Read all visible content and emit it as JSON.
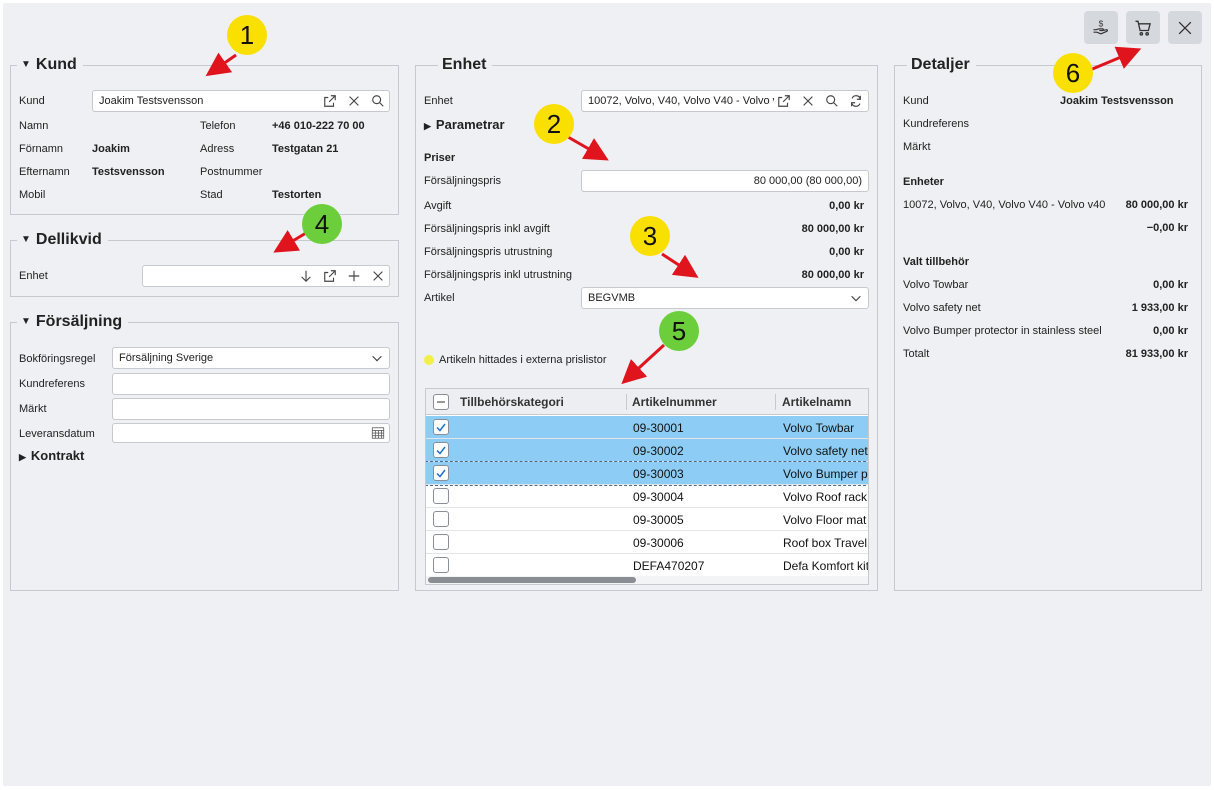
{
  "toolbar": {
    "payment_icon": "hand-coin-icon",
    "cart_icon": "cart-icon",
    "close_icon": "close-icon"
  },
  "badges": [
    "1",
    "2",
    "3",
    "4",
    "5",
    "6"
  ],
  "kund": {
    "title": "Kund",
    "kund_label": "Kund",
    "kund_value": "Joakim Testsvensson",
    "namn_label": "Namn",
    "fornamn_label": "Förnamn",
    "fornamn_value": "Joakim",
    "efternamn_label": "Efternamn",
    "efternamn_value": "Testsvensson",
    "mobil_label": "Mobil",
    "telefon_label": "Telefon",
    "telefon_value": "+46 010-222 70 00",
    "adress_label": "Adress",
    "adress_value": "Testgatan 21",
    "postnummer_label": "Postnummer",
    "stad_label": "Stad",
    "stad_value": "Testorten"
  },
  "dellikvid": {
    "title": "Dellikvid",
    "enhet_label": "Enhet",
    "enhet_value": ""
  },
  "forsaljning": {
    "title": "Försäljning",
    "bokforingsregel_label": "Bokföringsregel",
    "bokforingsregel_value": "Försäljning Sverige",
    "kundreferens_label": "Kundreferens",
    "markt_label": "Märkt",
    "leveransdatum_label": "Leveransdatum",
    "kontrakt_label": "Kontrakt"
  },
  "enhet": {
    "title": "Enhet",
    "enhet_label": "Enhet",
    "enhet_value": "10072, Volvo, V40, Volvo V40 - Volvo v40",
    "parametrar_label": "Parametrar",
    "priser_label": "Priser",
    "forsaljningspris_label": "Försäljningspris",
    "forsaljningspris_value": "80 000,00 (80 000,00)",
    "avgift_label": "Avgift",
    "avgift_value": "0,00 kr",
    "pris_inkl_avgift_label": "Försäljningspris inkl avgift",
    "pris_inkl_avgift_value": "80 000,00 kr",
    "pris_utrustning_label": "Försäljningspris utrustning",
    "pris_utrustning_value": "0,00 kr",
    "pris_inkl_utrustning_label": "Försäljningspris inkl utrustning",
    "pris_inkl_utrustning_value": "80 000,00 kr",
    "artikel_label": "Artikel",
    "artikel_value": "BEGVMB",
    "info_text": "Artikeln hittades i externa prislistor",
    "info_color": "#f2ee4a"
  },
  "grid": {
    "columns": [
      "Tillbehörskategori",
      "Artikelnummer",
      "Artikelnamn"
    ],
    "rows": [
      {
        "checked": true,
        "category": "",
        "number": "09-30001",
        "name": "Volvo Towbar"
      },
      {
        "checked": true,
        "category": "",
        "number": "09-30002",
        "name": "Volvo safety net"
      },
      {
        "checked": true,
        "category": "",
        "number": "09-30003",
        "name": "Volvo Bumper p"
      },
      {
        "checked": false,
        "category": "",
        "number": "09-30004",
        "name": "Volvo Roof rack"
      },
      {
        "checked": false,
        "category": "",
        "number": "09-30005",
        "name": "Volvo Floor mat"
      },
      {
        "checked": false,
        "category": "",
        "number": "09-30006",
        "name": "Roof box Travel"
      },
      {
        "checked": false,
        "category": "",
        "number": "DEFA470207",
        "name": "Defa Komfort kit"
      }
    ],
    "selected_color": "#8dcdf5"
  },
  "detaljer": {
    "title": "Detaljer",
    "kund_label": "Kund",
    "kund_value": "Joakim Testsvensson",
    "kundreferens_label": "Kundreferens",
    "markt_label": "Märkt",
    "enheter_label": "Enheter",
    "enhet_name": "10072, Volvo, V40, Volvo V40 - Volvo v40",
    "enhet_price": "80 000,00 kr",
    "enhet_discount": "−0,00 kr",
    "tillbehor_label": "Valt tillbehör",
    "tillbehor": [
      {
        "name": "Volvo Towbar",
        "price": "0,00 kr"
      },
      {
        "name": "Volvo safety net",
        "price": "1 933,00 kr"
      },
      {
        "name": "Volvo Bumper protector in stainless steel",
        "price": "0,00 kr"
      }
    ],
    "totalt_label": "Totalt",
    "totalt_value": "81 933,00 kr"
  }
}
